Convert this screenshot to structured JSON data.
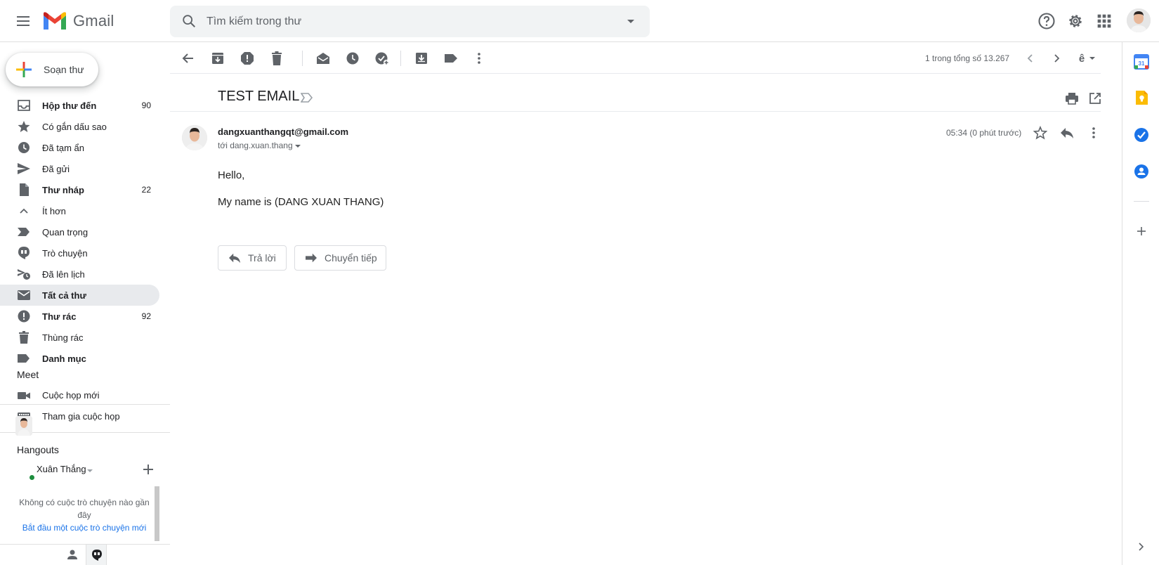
{
  "header": {
    "app_name": "Gmail",
    "search_placeholder": "Tìm kiếm trong thư"
  },
  "compose": {
    "label": "Soạn thư"
  },
  "nav": [
    {
      "label": "Hộp thư đến",
      "count": "90",
      "bold": true,
      "icon": "inbox-icon"
    },
    {
      "label": "Có gắn dấu sao",
      "count": "",
      "bold": false,
      "icon": "star-icon"
    },
    {
      "label": "Đã tạm ẩn",
      "count": "",
      "bold": false,
      "icon": "clock-icon"
    },
    {
      "label": "Đã gửi",
      "count": "",
      "bold": false,
      "icon": "send-icon"
    },
    {
      "label": "Thư nháp",
      "count": "22",
      "bold": true,
      "icon": "draft-icon"
    },
    {
      "label": "Ít hơn",
      "count": "",
      "bold": false,
      "icon": "chevron-up-icon"
    },
    {
      "label": "Quan trọng",
      "count": "",
      "bold": false,
      "icon": "important-icon"
    },
    {
      "label": "Trò chuyện",
      "count": "",
      "bold": false,
      "icon": "chat-icon"
    },
    {
      "label": "Đã lên lịch",
      "count": "",
      "bold": false,
      "icon": "scheduled-icon"
    },
    {
      "label": "Tất cả thư",
      "count": "",
      "bold": true,
      "icon": "mail-icon",
      "active": true
    },
    {
      "label": "Thư rác",
      "count": "92",
      "bold": true,
      "icon": "spam-icon"
    },
    {
      "label": "Thùng rác",
      "count": "",
      "bold": false,
      "icon": "trash-icon"
    },
    {
      "label": "Danh mục",
      "count": "",
      "bold": true,
      "icon": "label-icon"
    }
  ],
  "meet": {
    "title": "Meet",
    "new_meeting": "Cuộc họp mới",
    "join_meeting": "Tham gia cuộc họp"
  },
  "hangouts": {
    "title": "Hangouts",
    "user_name": "Xuân Thắng",
    "empty_text": "Không có cuộc trò chuyện nào gần đây",
    "start_link": "Bắt đầu một cuộc trò chuyện mới"
  },
  "toolbar": {
    "pager_text": "1 trong tổng số 13.267",
    "input_tool_label": "ê"
  },
  "message": {
    "subject": "TEST EMAIL",
    "sender": "dangxuanthangqt@gmail.com",
    "recipient": "tới dang.xuan.thang",
    "timestamp": "05:34 (0 phút trước)",
    "body": [
      "Hello,",
      "My name is (DANG XUAN THANG)"
    ]
  },
  "actions": {
    "reply_label": "Trả lời",
    "forward_label": "Chuyển tiếp"
  },
  "colors": {
    "accent_blue": "#1a73e8",
    "active_nav_bg": "#e8eaed",
    "online_green": "#1e8e3e"
  }
}
